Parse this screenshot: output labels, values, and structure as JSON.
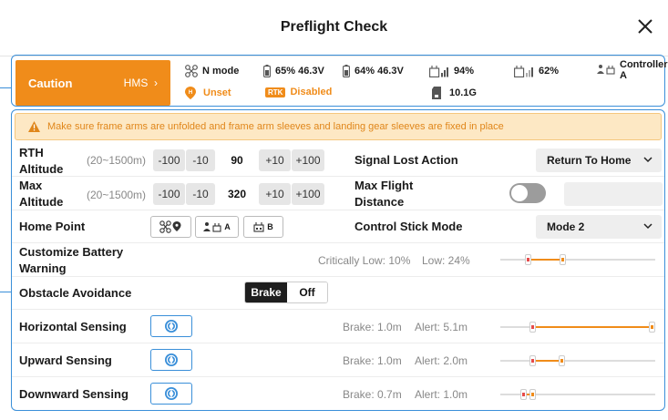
{
  "header": {
    "title": "Preflight Check"
  },
  "status_bar": {
    "caution_label": "Caution",
    "hms_label": "HMS",
    "flight_mode": "N mode",
    "battery1": "65% 46.3V",
    "battery2": "64% 46.3V",
    "signal1": "94%",
    "signal2": "62%",
    "controller": "Controller",
    "controller_sub": "A",
    "home_status": "Unset",
    "rtk_badge": "RTK",
    "rtk_status": "Disabled",
    "storage": "10.1G"
  },
  "warning": "Make sure frame arms are unfolded and frame arm sleeves and landing gear sleeves are fixed in place",
  "rth_altitude": {
    "label_line1": "RTH",
    "label_line2": "Altitude",
    "range": "(20~1500m)",
    "dec100": "-100",
    "dec10": "-10",
    "value": "90",
    "inc10": "+10",
    "inc100": "+100"
  },
  "max_altitude": {
    "label_line1": "Max",
    "label_line2": "Altitude",
    "range": "(20~1500m)",
    "dec100": "-100",
    "dec10": "-10",
    "value": "320",
    "inc10": "+10",
    "inc100": "+100"
  },
  "signal_lost": {
    "label": "Signal Lost Action",
    "value": "Return To Home"
  },
  "max_distance": {
    "label_line1": "Max Flight",
    "label_line2": "Distance",
    "enabled": false
  },
  "home_point": {
    "label": "Home Point",
    "rc_a": "A",
    "rc_b": "B"
  },
  "stick_mode": {
    "label": "Control Stick Mode",
    "value": "Mode 2"
  },
  "battery_warning": {
    "label_line1": "Customize Battery",
    "label_line2": "Warning",
    "critical_text": "Critically Low: 10%",
    "low_text": "Low: 24%",
    "critical_pct": 10,
    "low_pct": 24
  },
  "obstacle": {
    "label": "Obstacle Avoidance",
    "brake": "Brake",
    "off": "Off",
    "selected": "Brake"
  },
  "sensing": [
    {
      "label": "Horizontal Sensing",
      "brake_text": "Brake: 1.0m",
      "alert_text": "Alert: 5.1m",
      "brake_m": 1.0,
      "alert_m": 5.1
    },
    {
      "label": "Upward Sensing",
      "brake_text": "Brake: 1.0m",
      "alert_text": "Alert: 2.0m",
      "brake_m": 1.0,
      "alert_m": 2.0
    },
    {
      "label": "Downward Sensing",
      "brake_text": "Brake: 0.7m",
      "alert_text": "Alert: 1.0m",
      "brake_m": 0.7,
      "alert_m": 1.0
    }
  ],
  "colors": {
    "accent": "#f08c1a",
    "frame": "#3a8fd9",
    "critical": "#e64b4b"
  }
}
